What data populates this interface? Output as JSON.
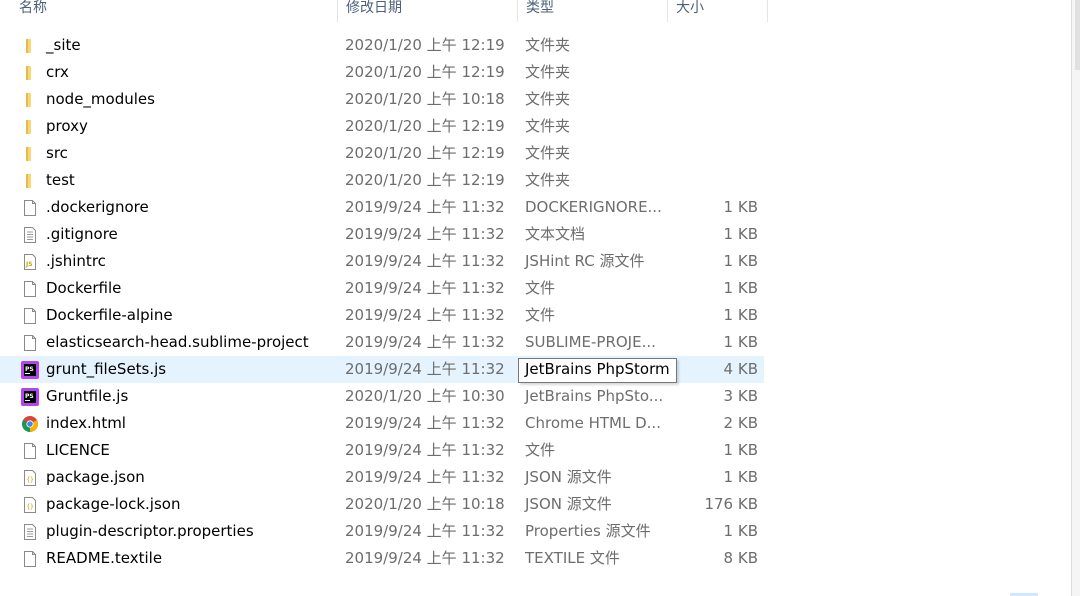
{
  "columns": {
    "name": "名称",
    "date": "修改日期",
    "type": "类型",
    "size": "大小"
  },
  "rows": [
    {
      "name": "_site",
      "date": "2020/1/20 上午 12:19",
      "type": "文件夹",
      "size": "",
      "icon": "folder-icon"
    },
    {
      "name": "crx",
      "date": "2020/1/20 上午 12:19",
      "type": "文件夹",
      "size": "",
      "icon": "folder-icon"
    },
    {
      "name": "node_modules",
      "date": "2020/1/20 上午 10:18",
      "type": "文件夹",
      "size": "",
      "icon": "folder-icon"
    },
    {
      "name": "proxy",
      "date": "2020/1/20 上午 12:19",
      "type": "文件夹",
      "size": "",
      "icon": "folder-icon"
    },
    {
      "name": "src",
      "date": "2020/1/20 上午 12:19",
      "type": "文件夹",
      "size": "",
      "icon": "folder-icon"
    },
    {
      "name": "test",
      "date": "2020/1/20 上午 12:19",
      "type": "文件夹",
      "size": "",
      "icon": "folder-icon"
    },
    {
      "name": ".dockerignore",
      "date": "2019/9/24 上午 11:32",
      "type": "DOCKERIGNORE...",
      "size": "1 KB",
      "icon": "file-icon"
    },
    {
      "name": ".gitignore",
      "date": "2019/9/24 上午 11:32",
      "type": "文本文档",
      "size": "1 KB",
      "icon": "text-file-icon"
    },
    {
      "name": ".jshintrc",
      "date": "2019/9/24 上午 11:32",
      "type": "JSHint RC 源文件",
      "size": "1 KB",
      "icon": "js-file-icon"
    },
    {
      "name": "Dockerfile",
      "date": "2019/9/24 上午 11:32",
      "type": "文件",
      "size": "1 KB",
      "icon": "file-icon"
    },
    {
      "name": "Dockerfile-alpine",
      "date": "2019/9/24 上午 11:32",
      "type": "文件",
      "size": "1 KB",
      "icon": "file-icon"
    },
    {
      "name": "elasticsearch-head.sublime-project",
      "date": "2019/9/24 上午 11:32",
      "type": "SUBLIME-PROJE...",
      "size": "1 KB",
      "icon": "file-icon"
    },
    {
      "name": "grunt_fileSets.js",
      "date": "2019/9/24 上午 11:32",
      "type": "JetBrains PhpStorm",
      "size": "4 KB",
      "icon": "phpstorm-icon"
    },
    {
      "name": "Gruntfile.js",
      "date": "2020/1/20 上午 10:30",
      "type": "JetBrains PhpSto...",
      "size": "3 KB",
      "icon": "phpstorm-icon"
    },
    {
      "name": "index.html",
      "date": "2019/9/24 上午 11:32",
      "type": "Chrome HTML D...",
      "size": "2 KB",
      "icon": "chrome-icon"
    },
    {
      "name": "LICENCE",
      "date": "2019/9/24 上午 11:32",
      "type": "文件",
      "size": "1 KB",
      "icon": "file-icon"
    },
    {
      "name": "package.json",
      "date": "2019/9/24 上午 11:32",
      "type": "JSON 源文件",
      "size": "1 KB",
      "icon": "json-file-icon"
    },
    {
      "name": "package-lock.json",
      "date": "2020/1/20 上午 10:18",
      "type": "JSON 源文件",
      "size": "176 KB",
      "icon": "json-file-icon"
    },
    {
      "name": "plugin-descriptor.properties",
      "date": "2019/9/24 上午 11:32",
      "type": "Properties 源文件",
      "size": "1 KB",
      "icon": "text-file-icon"
    },
    {
      "name": "README.textile",
      "date": "2019/9/24 上午 11:32",
      "type": "TEXTILE 文件",
      "size": "8 KB",
      "icon": "file-icon"
    }
  ],
  "hovered_row": "grunt_fileSets.js",
  "colors": {
    "header_text": "#4c607a",
    "secondary_text": "#6d6d6d",
    "hover_bg": "#e5f3ff",
    "folder_yellow": "#f8d775"
  }
}
